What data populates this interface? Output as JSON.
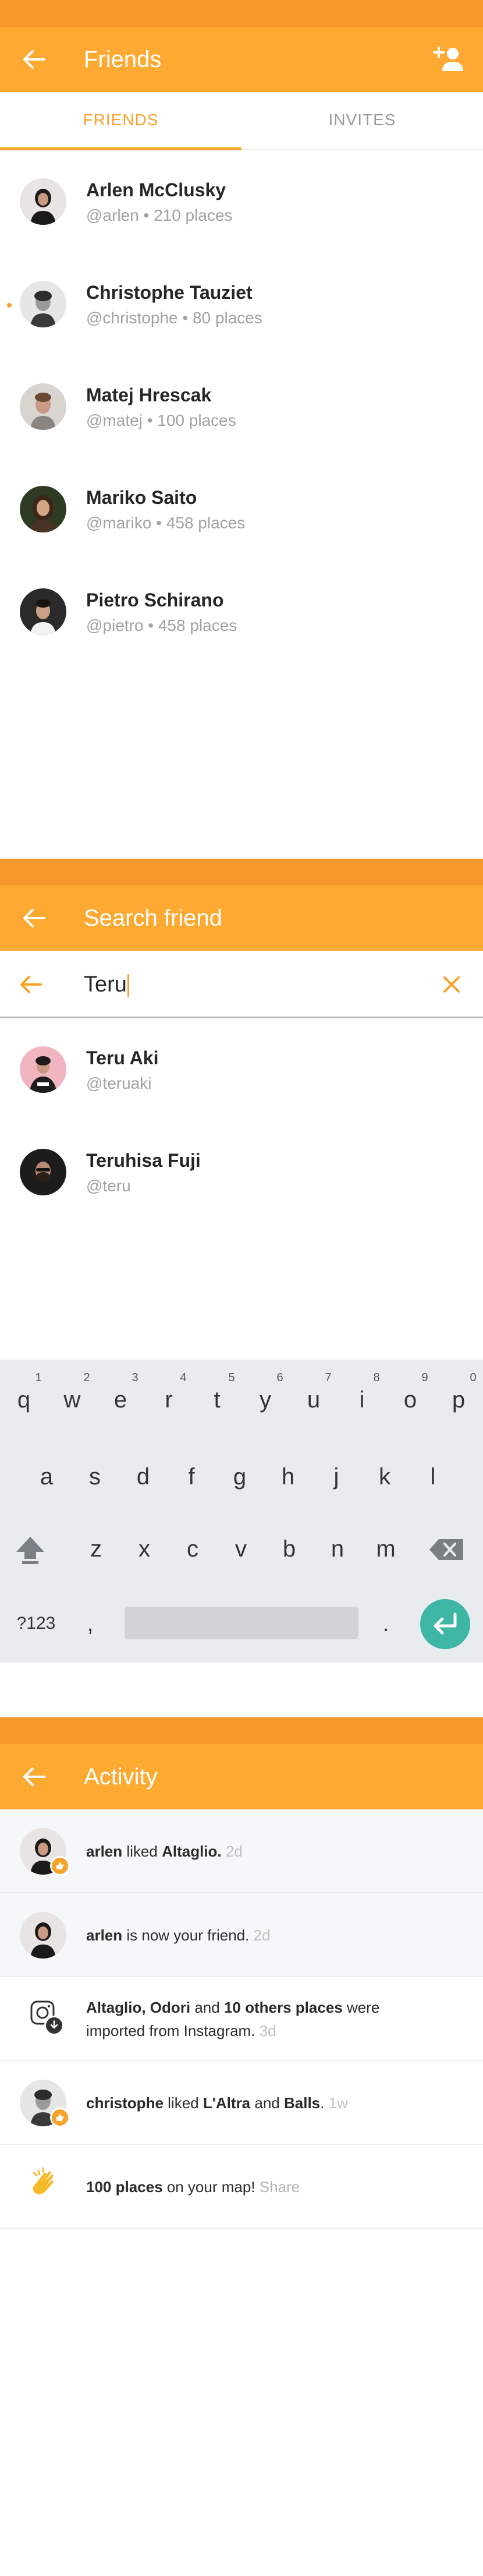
{
  "friends_screen": {
    "title": "Friends",
    "tabs": [
      {
        "label": "FRIENDS",
        "active": true
      },
      {
        "label": "INVITES",
        "active": false
      }
    ],
    "friends": [
      {
        "name": "Arlen McClusky",
        "handle": "@arlen",
        "places": "210 places"
      },
      {
        "name": "Christophe Tauziet",
        "handle": "@christophe",
        "places": "80 places"
      },
      {
        "name": "Matej Hrescak",
        "handle": "@matej",
        "places": "100 places"
      },
      {
        "name": "Mariko Saito",
        "handle": "@mariko",
        "places": "458 places"
      },
      {
        "name": "Pietro Schirano",
        "handle": "@pietro",
        "places": "458 places"
      }
    ],
    "separator": "•"
  },
  "search_screen": {
    "title": "Search friend",
    "query": "Teru",
    "results": [
      {
        "name": "Teru Aki",
        "handle": "@teruaki"
      },
      {
        "name": "Teruhisa Fuji",
        "handle": "@teru"
      }
    ]
  },
  "keyboard": {
    "row1": [
      "q",
      "w",
      "e",
      "r",
      "t",
      "y",
      "u",
      "i",
      "o",
      "p"
    ],
    "row1_numbers": [
      "1",
      "2",
      "3",
      "4",
      "5",
      "6",
      "7",
      "8",
      "9",
      "0"
    ],
    "row2": [
      "a",
      "s",
      "d",
      "f",
      "g",
      "h",
      "j",
      "k",
      "l"
    ],
    "row3": [
      "z",
      "x",
      "c",
      "v",
      "b",
      "n",
      "m"
    ],
    "symbols_label": "?123",
    "comma": ",",
    "period": "."
  },
  "activity_screen": {
    "title": "Activity",
    "items": [
      {
        "actor": "arlen",
        "text": " liked ",
        "object": "Altaglio.",
        "time": "2d"
      },
      {
        "actor": "arlen",
        "text": " is now your friend.",
        "time": "2d"
      },
      {
        "line1_a": "Altaglio, Odori",
        "line1_b": " and ",
        "line1_c": "10 others places",
        "line1_d": " were",
        "line2": "imported from Instagram.",
        "time": "3d"
      },
      {
        "actor": "christophe",
        "text": " liked ",
        "object1": "L'Altra",
        "and": " and ",
        "object2": "Balls",
        "end": ".",
        "time": "1w"
      },
      {
        "bold": "100 places",
        "text": " on your map! ",
        "link": "Share"
      }
    ]
  },
  "colors": {
    "status_bar": "#f7982a",
    "app_bar": "#fda932",
    "accent": "#f7a22b",
    "enter_key": "#3eb6a6"
  },
  "icons": [
    "back-arrow-icon",
    "add-person-icon",
    "close-icon",
    "shift-icon",
    "backspace-icon",
    "enter-icon",
    "like-badge-icon",
    "instagram-icon",
    "download-badge-icon",
    "clapping-hands-icon"
  ]
}
